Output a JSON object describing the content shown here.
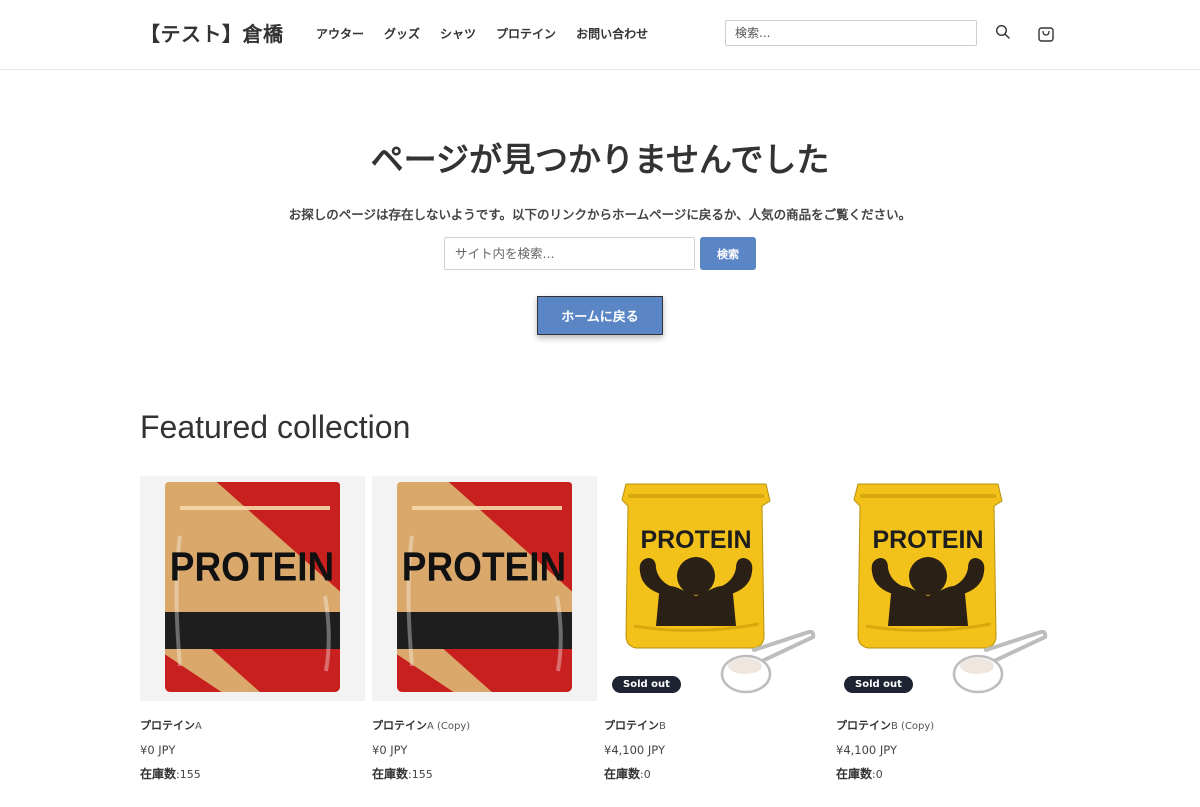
{
  "header": {
    "logo": "【テスト】倉橋",
    "nav": [
      "アウター",
      "グッズ",
      "シャツ",
      "プロテイン",
      "お問い合わせ"
    ],
    "search_placeholder": "検索..."
  },
  "not_found": {
    "title": "ページが見つかりませんでした",
    "description": "お探しのページは存在しないようです。以下のリンクからホームページに戻るか、人気の商品をご覧ください。",
    "search_placeholder": "サイト内を検索...",
    "search_button": "検索",
    "home_button": "ホームに戻る"
  },
  "featured": {
    "title": "Featured collection",
    "products": [
      {
        "name": "プロテイン",
        "suffix": "A",
        "price": "¥0 JPY",
        "stock_label": "在庫数",
        "stock": ":155",
        "sold_out": "",
        "image_text": "PROTEIN"
      },
      {
        "name": "プロテイン",
        "suffix": "A (Copy)",
        "price": "¥0 JPY",
        "stock_label": "在庫数",
        "stock": ":155",
        "sold_out": "",
        "image_text": "PROTEIN"
      },
      {
        "name": "プロテイン",
        "suffix": "B",
        "price": "¥4,100 JPY",
        "stock_label": "在庫数",
        "stock": ":0",
        "sold_out": "Sold out",
        "image_text": "PROTEIN"
      },
      {
        "name": "プロテイン",
        "suffix": "B (Copy)",
        "price": "¥4,100 JPY",
        "stock_label": "在庫数",
        "stock": ":0",
        "sold_out": "Sold out",
        "image_text": "PROTEIN"
      }
    ]
  },
  "colors": {
    "accent": "#5a86c6",
    "badge": "#1f2433",
    "pouch_red": "#c8201f",
    "pouch_tan": "#d9a86a",
    "pouch_yellow": "#f2c21a"
  }
}
